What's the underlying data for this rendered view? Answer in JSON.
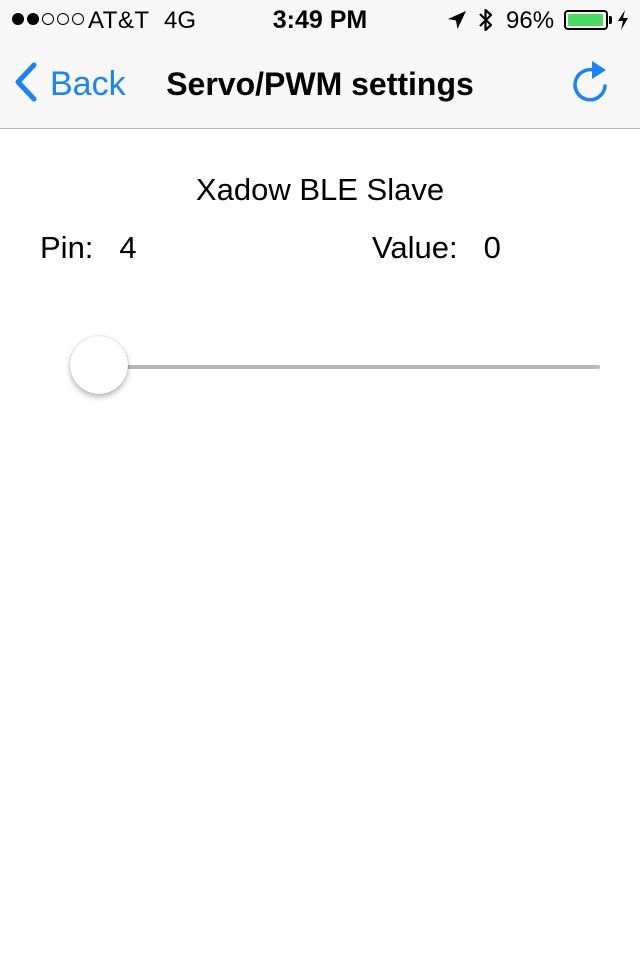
{
  "status_bar": {
    "signal_bars_filled": 2,
    "signal_bars_total": 5,
    "carrier": "AT&T",
    "network": "4G",
    "time": "3:49 PM",
    "battery_percent": "96%",
    "battery_level": 0.96,
    "battery_color": "#4cd964",
    "icons": [
      "location-arrow-icon",
      "bluetooth-icon",
      "battery-icon",
      "charging-bolt-icon"
    ]
  },
  "nav": {
    "back_label": "Back",
    "title": "Servo/PWM settings",
    "accent_color": "#1a82fb",
    "icons": [
      "chevron-left-icon",
      "refresh-icon"
    ]
  },
  "content": {
    "device_name": "Xadow BLE Slave",
    "pin_label": "Pin:",
    "pin_value": "4",
    "value_label": "Value:",
    "value_value": "0",
    "slider_level": 0
  }
}
